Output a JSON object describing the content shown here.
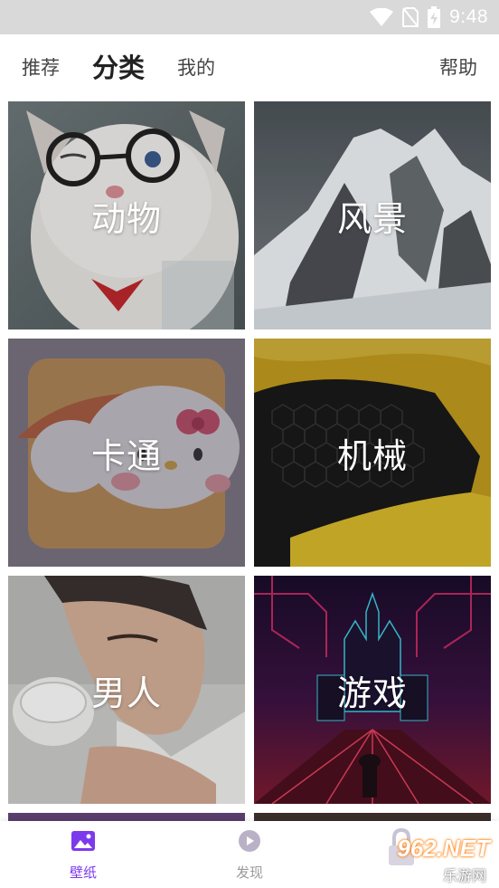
{
  "status_bar": {
    "time": "9:48",
    "icons": [
      "wifi-icon",
      "no-sim-icon",
      "battery-charging-icon"
    ]
  },
  "top_nav": {
    "tabs": [
      {
        "label": "推荐",
        "active": false
      },
      {
        "label": "分类",
        "active": true
      },
      {
        "label": "我的",
        "active": false
      }
    ],
    "help_label": "帮助"
  },
  "categories": [
    {
      "label": "动物",
      "image": "cat-with-glasses"
    },
    {
      "label": "风景",
      "image": "snowy-mountain"
    },
    {
      "label": "卡通",
      "image": "hello-kitty-sushi"
    },
    {
      "label": "机械",
      "image": "yellow-car-grille"
    },
    {
      "label": "男人",
      "image": "man-portrait"
    },
    {
      "label": "游戏",
      "image": "neon-castle"
    }
  ],
  "bottom_nav": {
    "items": [
      {
        "label": "壁纸",
        "icon": "image-icon",
        "active": true
      },
      {
        "label": "发现",
        "icon": "discover-bubble-icon",
        "active": false
      },
      {
        "label": "",
        "icon": "lock-icon",
        "active": false
      }
    ]
  },
  "watermark": {
    "brand": "962.NET",
    "sub": "乐游网"
  },
  "colors": {
    "accent": "#7c3aed",
    "status_bar": "#d9d9d9",
    "inactive_label": "#9a9a9a"
  }
}
